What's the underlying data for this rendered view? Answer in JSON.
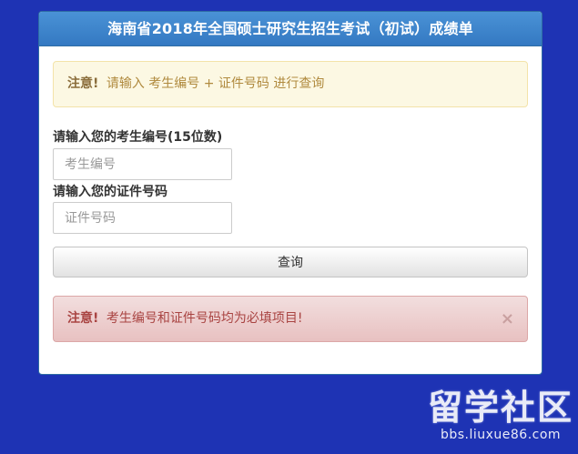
{
  "panel": {
    "title": "海南省2018年全国硕士研究生招生考试（初试）成绩单"
  },
  "notice": {
    "strong": "注意!",
    "message": "请输入 考生编号 + 证件号码 进行查询"
  },
  "form": {
    "exam_id_label": "请输入您的考生编号(15位数)",
    "exam_id_placeholder": "考生编号",
    "id_number_label": "请输入您的证件号码",
    "id_number_placeholder": "证件号码",
    "submit_label": "查询"
  },
  "error": {
    "strong": "注意!",
    "message": "考生编号和证件号码均为必填项目!",
    "close": "×"
  },
  "watermark": {
    "logo": "留学社区",
    "url": "bbs.liuxue86.com"
  },
  "colors": {
    "background": "#1e33b4",
    "header": "#3479c2",
    "warning_bg": "#fcf8e3",
    "danger_bg": "#f2dede",
    "danger_text": "#a94442"
  }
}
